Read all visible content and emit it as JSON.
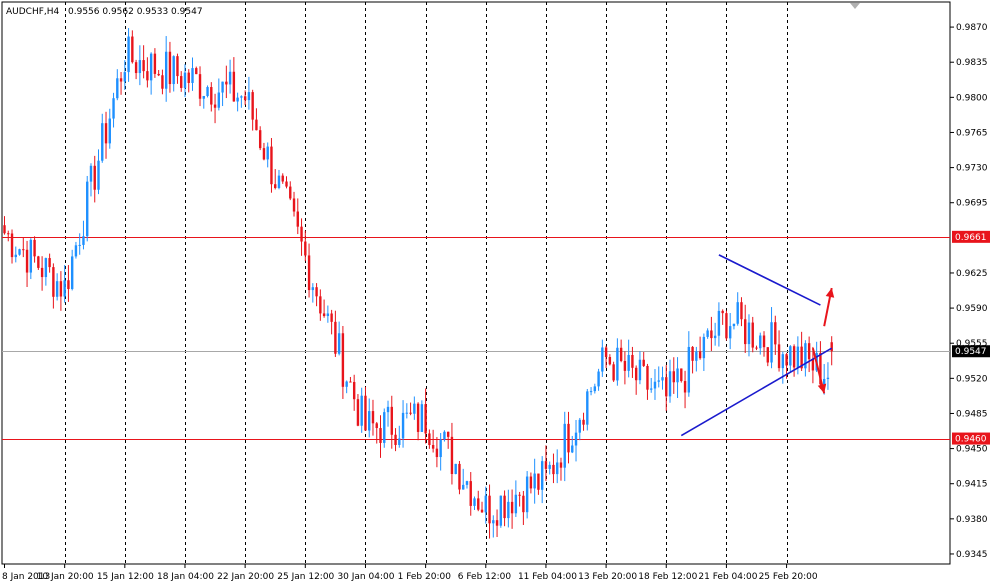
{
  "header": {
    "symbol_label": "AUDCHF,H4",
    "ohlc_label": "0.9556 0.9562 0.9533 0.9547"
  },
  "colors": {
    "bull": "#1E90FF",
    "bear": "#E8141B",
    "level_line": "#E8141B",
    "trend_line": "#1A1ACD",
    "arrow": "#E8141B",
    "grid": "#000000",
    "current_price_line": "#A8A8A8"
  },
  "price_axis": {
    "min": 0.9335,
    "max": 0.9895,
    "ticks": [
      "0.9870",
      "0.9835",
      "0.9800",
      "0.9765",
      "0.9730",
      "0.9695",
      "0.9625",
      "0.9590",
      "0.9555",
      "0.9520",
      "0.9485",
      "0.9450",
      "0.9415",
      "0.9380",
      "0.9345"
    ],
    "tick_values": [
      0.987,
      0.9835,
      0.98,
      0.9765,
      0.973,
      0.9695,
      0.9625,
      0.959,
      0.9555,
      0.952,
      0.9485,
      0.945,
      0.9415,
      0.938,
      0.9345
    ]
  },
  "time_axis": {
    "labels": [
      "8 Jan 2013",
      "10 Jan 20:00",
      "15 Jan 12:00",
      "18 Jan 04:00",
      "22 Jan 20:00",
      "25 Jan 12:00",
      "30 Jan 04:00",
      "1 Feb 20:00",
      "6 Feb 12:00",
      "11 Feb 04:00",
      "13 Feb 20:00",
      "18 Feb 12:00",
      "21 Feb 04:00",
      "25 Feb 20:00"
    ],
    "label_bars": [
      0,
      16,
      32,
      48,
      64,
      80,
      96,
      112,
      128,
      144,
      160,
      176,
      192,
      208
    ]
  },
  "chart_data": {
    "type": "candlestick",
    "symbol": "AUDCHF",
    "timeframe": "H4",
    "last_bar": {
      "open": 0.9556,
      "high": 0.9562,
      "low": 0.9533,
      "close": 0.9547
    },
    "ylim": [
      0.9335,
      0.9895
    ],
    "grid": "vertical dashed",
    "key_points": [
      {
        "label": "8 Jan 2013",
        "close": 0.9665
      },
      {
        "label": "10 Jan 20:00",
        "close": 0.961
      },
      {
        "label": "15 Jan 12:00",
        "close": 0.984
      },
      {
        "label": "18 Jan 04:00",
        "close": 0.982
      },
      {
        "label": "22 Jan 20:00",
        "close": 0.98
      },
      {
        "label": "25 Jan 12:00",
        "close": 0.964
      },
      {
        "label": "30 Jan 04:00",
        "close": 0.947
      },
      {
        "label": "1 Feb 20:00",
        "close": 0.948
      },
      {
        "label": "6 Feb 12:00",
        "close": 0.939
      },
      {
        "label": "11 Feb 04:00",
        "close": 0.942
      },
      {
        "label": "13 Feb 20:00",
        "close": 0.954
      },
      {
        "label": "18 Feb 12:00",
        "close": 0.95
      },
      {
        "label": "21 Feb 04:00",
        "close": 0.958
      },
      {
        "label": "25 Feb 20:00",
        "close": 0.9547
      }
    ],
    "horizontal_levels": [
      {
        "value": 0.9661,
        "label": "0.9661"
      },
      {
        "value": 0.946,
        "label": "0.9460"
      }
    ],
    "current_price": {
      "value": 0.9547,
      "label": "0.9547"
    },
    "trend_lines": [
      {
        "from": {
          "bar": 190,
          "price": 0.9643
        },
        "to": {
          "bar": 217,
          "price": 0.9593
        }
      },
      {
        "from": {
          "bar": 180,
          "price": 0.9463
        },
        "to": {
          "bar": 220,
          "price": 0.955
        }
      }
    ],
    "arrows": [
      {
        "from": {
          "bar": 218,
          "price": 0.9572
        },
        "to": {
          "bar": 220,
          "price": 0.961
        }
      },
      {
        "from": {
          "bar": 215,
          "price": 0.955
        },
        "to": {
          "bar": 218,
          "price": 0.9505
        }
      }
    ]
  }
}
